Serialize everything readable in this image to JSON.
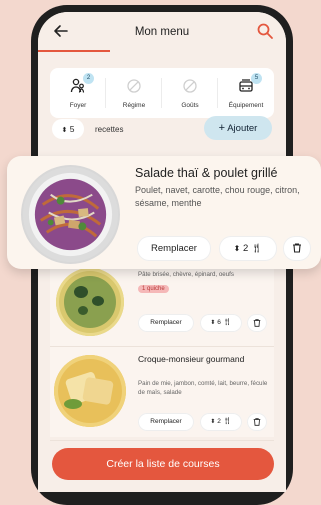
{
  "header": {
    "title": "Mon menu"
  },
  "filters": [
    {
      "label": "Foyer",
      "badge": "2",
      "icon": "people-icon"
    },
    {
      "label": "Régime",
      "badge": "",
      "icon": "disabled-icon"
    },
    {
      "label": "Goûts",
      "badge": "",
      "icon": "disabled-icon"
    },
    {
      "label": "Équipement",
      "badge": "5",
      "icon": "appliance-icon"
    }
  ],
  "recipes_bar": {
    "count": "5",
    "label": "recettes",
    "add_label": "Ajouter"
  },
  "highlight_card": {
    "title": "Salade thaï & poulet grillé",
    "ingredients": "Poulet, navet, carotte, chou rouge, citron, sésame, menthe",
    "replace_label": "Remplacer",
    "portions": "2"
  },
  "recipes": [
    {
      "ingredients": "Pâte brisée, chèvre, épinard, oeufs",
      "tag": "1 quiche",
      "replace_label": "Remplacer",
      "portions": "6"
    },
    {
      "title": "Croque-monsieur gourmand",
      "ingredients": "Pain de mie, jambon, comté, lait, beurre, fécule de maïs, salade",
      "replace_label": "Remplacer",
      "portions": "2"
    }
  ],
  "cta": {
    "label": "Créer la liste de courses"
  },
  "colors": {
    "accent": "#e4573e",
    "add_button": "#cfe6ef",
    "background": "#f3d8ce",
    "tag": "#f5b8b8"
  }
}
